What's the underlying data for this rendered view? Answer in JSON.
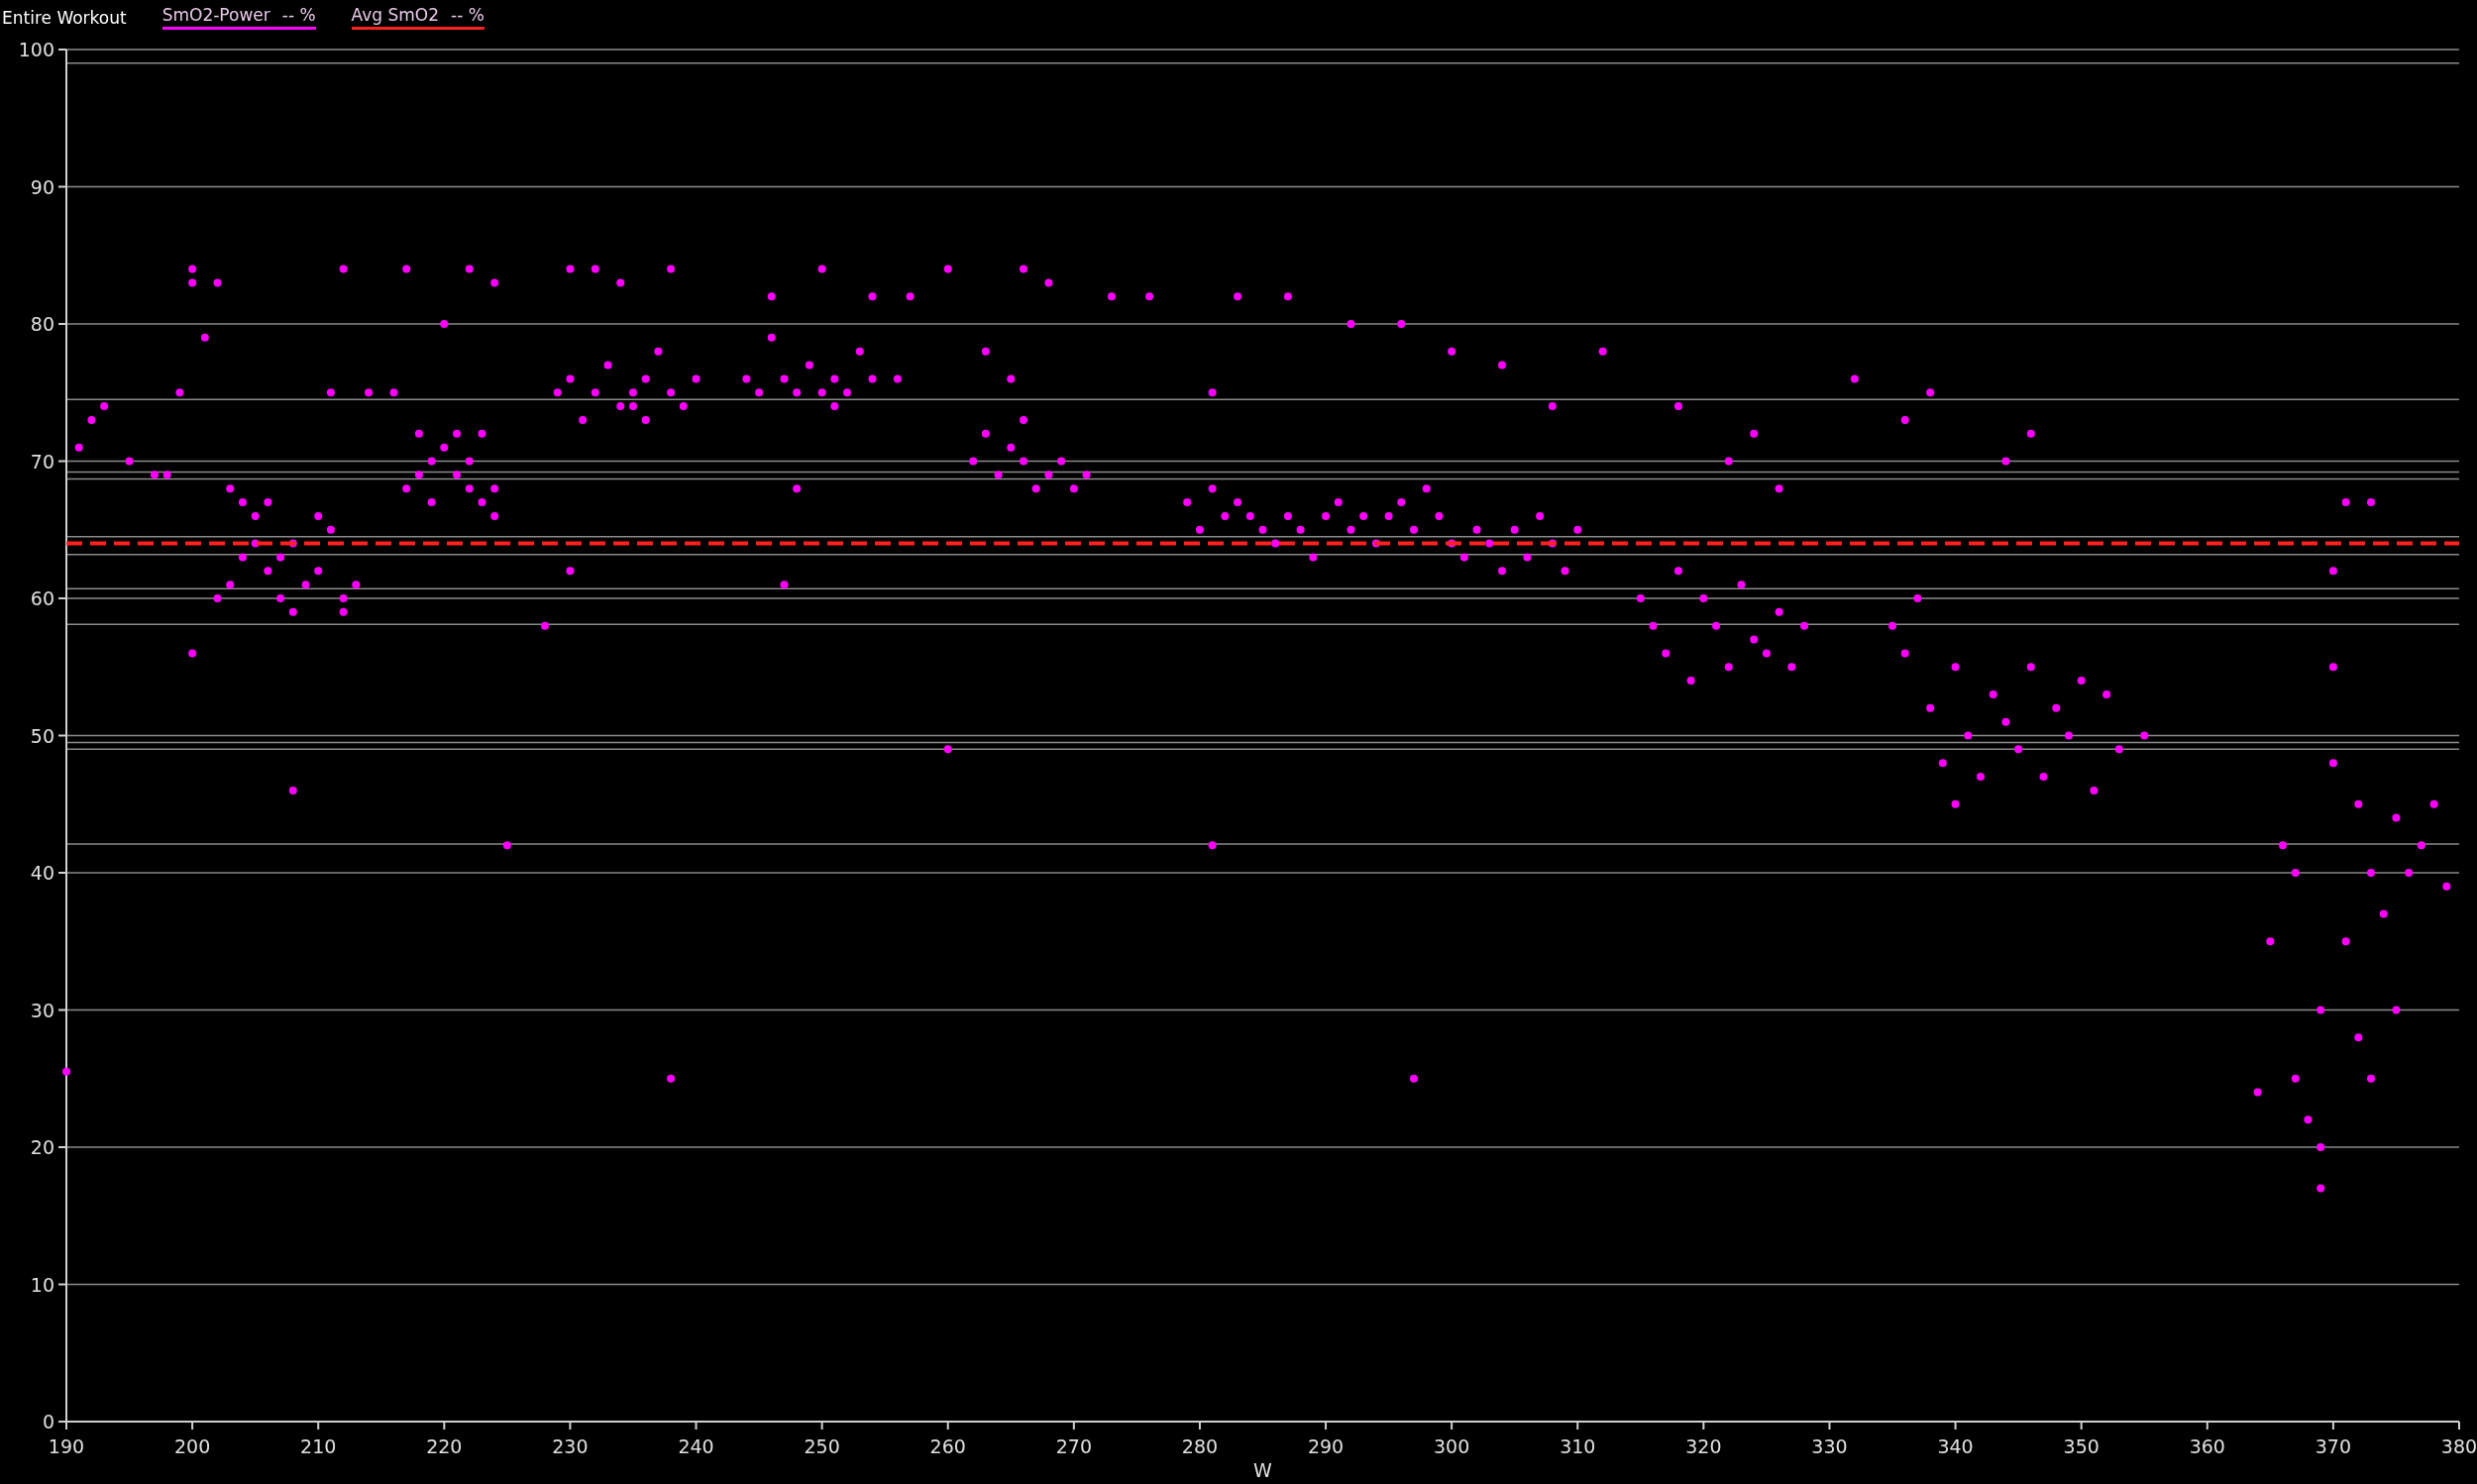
{
  "header": {
    "title": "Entire Workout",
    "legend": [
      {
        "reading": "-- %"
      },
      {
        "reading": "-- %"
      }
    ]
  },
  "chart": {
    "chart_data": {
      "type": "scatter",
      "xlabel": "W",
      "xlim": [
        190,
        380
      ],
      "ylim": [
        0,
        100
      ],
      "xticks": [
        190,
        200,
        210,
        220,
        230,
        240,
        250,
        260,
        270,
        280,
        290,
        300,
        310,
        320,
        330,
        340,
        350,
        360,
        370,
        380
      ],
      "yticks": [
        0,
        10,
        20,
        30,
        40,
        50,
        60,
        70,
        80,
        90,
        100
      ],
      "grid": true,
      "ref_lines": [
        {
          "axis": "y",
          "value": 99
        },
        {
          "axis": "y",
          "value": 74.5
        },
        {
          "axis": "y",
          "value": 69.2
        },
        {
          "axis": "y",
          "value": 68.7
        },
        {
          "axis": "y",
          "value": 64.5
        },
        {
          "axis": "y",
          "value": 63.2
        },
        {
          "axis": "y",
          "value": 60.7
        },
        {
          "axis": "y",
          "value": 58.1
        },
        {
          "axis": "y",
          "value": 49.5
        },
        {
          "axis": "y",
          "value": 49
        },
        {
          "axis": "y",
          "value": 42.1
        }
      ],
      "series": [
        {
          "name": "SmO2-Power",
          "color": "#ff00ff",
          "x": [
            202,
            203,
            204,
            205,
            206,
            206,
            207,
            207,
            208,
            208,
            209,
            210,
            210,
            211,
            212,
            213,
            212,
            205,
            204,
            203,
            200,
            200,
            201,
            202,
            199,
            198,
            191,
            192,
            193,
            195,
            197,
            190,
            200,
            208,
            211,
            212,
            214,
            216,
            217,
            218,
            219,
            220,
            221,
            222,
            222,
            223,
            224,
            224,
            219,
            221,
            223,
            218,
            225,
            220,
            222,
            224,
            217,
            229,
            230,
            231,
            232,
            233,
            234,
            235,
            235,
            236,
            236,
            237,
            238,
            239,
            240,
            238,
            230,
            232,
            234,
            238,
            228,
            230,
            244,
            245,
            246,
            246,
            247,
            248,
            249,
            250,
            251,
            251,
            252,
            253,
            254,
            256,
            247,
            248,
            250,
            254,
            257,
            262,
            263,
            264,
            265,
            266,
            266,
            267,
            268,
            269,
            270,
            271,
            265,
            263,
            260,
            260,
            266,
            268,
            273,
            276,
            279,
            280,
            281,
            282,
            283,
            284,
            285,
            286,
            287,
            288,
            289,
            290,
            291,
            292,
            293,
            294,
            295,
            296,
            297,
            298,
            299,
            300,
            301,
            302,
            303,
            304,
            305,
            306,
            307,
            308,
            309,
            310,
            281,
            297,
            281,
            283,
            287,
            292,
            296,
            300,
            304,
            308,
            312,
            315,
            316,
            317,
            318,
            319,
            320,
            321,
            322,
            323,
            324,
            325,
            326,
            327,
            328,
            324,
            322,
            318,
            326,
            335,
            336,
            337,
            338,
            339,
            340,
            340,
            341,
            342,
            343,
            344,
            345,
            346,
            347,
            348,
            349,
            350,
            351,
            352,
            353,
            355,
            344,
            346,
            336,
            332,
            338,
            364,
            365,
            366,
            367,
            367,
            368,
            369,
            369,
            370,
            370,
            370,
            371,
            371,
            372,
            372,
            373,
            373,
            374,
            375,
            375,
            376,
            377,
            378,
            379,
            369,
            373
          ],
          "values": [
            60,
            61,
            67,
            66,
            67,
            62,
            60,
            63,
            59,
            64,
            61,
            62,
            66,
            65,
            60,
            61,
            59,
            64,
            63,
            68,
            84,
            83,
            79,
            83,
            75,
            69,
            71,
            73,
            74,
            70,
            69,
            25.5,
            56,
            46,
            75,
            84,
            75,
            75,
            68,
            69,
            70,
            71,
            72,
            70,
            68,
            67,
            66,
            68,
            67,
            69,
            72,
            72,
            42,
            80,
            84,
            83,
            84,
            75,
            76,
            73,
            75,
            77,
            74,
            74,
            75,
            73,
            76,
            78,
            75,
            74,
            76,
            25,
            84,
            84,
            83,
            84,
            58,
            62,
            76,
            75,
            79,
            82,
            76,
            75,
            77,
            75,
            74,
            76,
            75,
            78,
            76,
            76,
            61,
            68,
            84,
            82,
            82,
            70,
            72,
            69,
            71,
            70,
            73,
            68,
            69,
            70,
            68,
            69,
            76,
            78,
            49,
            84,
            84,
            83,
            82,
            82,
            67,
            65,
            68,
            66,
            67,
            66,
            65,
            64,
            66,
            65,
            63,
            66,
            67,
            65,
            66,
            64,
            66,
            67,
            65,
            68,
            66,
            64,
            63,
            65,
            64,
            62,
            65,
            63,
            66,
            64,
            62,
            65,
            42,
            25,
            75,
            82,
            82,
            80,
            80,
            78,
            77,
            74,
            78,
            60,
            58,
            56,
            62,
            54,
            60,
            58,
            55,
            61,
            57,
            56,
            59,
            55,
            58,
            72,
            70,
            74,
            68,
            58,
            56,
            60,
            52,
            48,
            45,
            55,
            50,
            47,
            53,
            51,
            49,
            55,
            47,
            52,
            50,
            54,
            46,
            53,
            49,
            50,
            70,
            72,
            73,
            76,
            75,
            24,
            35,
            42,
            40,
            25,
            22,
            20,
            30,
            55,
            48,
            62,
            67,
            35,
            45,
            28,
            40,
            25,
            37,
            44,
            30,
            40,
            42,
            45,
            39,
            17,
            67
          ]
        },
        {
          "name": "Avg SmO2",
          "type": "line",
          "line_style": "dashed",
          "color": "#ff2020",
          "x": [
            190,
            380
          ],
          "values": [
            64,
            64
          ]
        }
      ]
    }
  }
}
